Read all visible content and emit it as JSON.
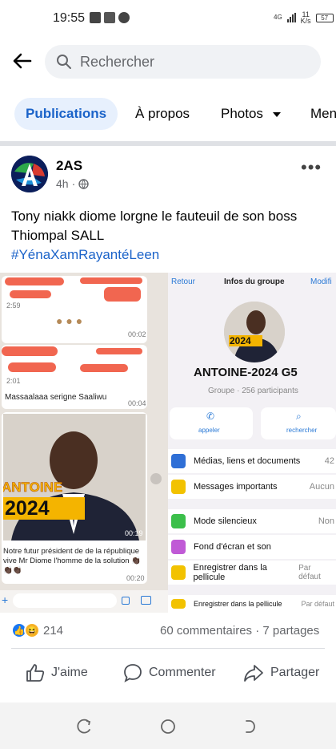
{
  "status_bar": {
    "time": "19:55",
    "network": "4G",
    "speed_value": "11",
    "speed_unit": "K/s",
    "battery": "57"
  },
  "search": {
    "placeholder": "Rechercher"
  },
  "tabs": [
    {
      "label": "Publications",
      "active": true
    },
    {
      "label": "À propos"
    },
    {
      "label": "Photos"
    },
    {
      "label": "Men"
    }
  ],
  "post": {
    "author": "2AS",
    "time": "4h",
    "text": "Tony niakk diome lorgne le fauteuil de son boss Thiompal SALL",
    "hashtag": "#YénaXamRayantéLeen",
    "image": {
      "chat": {
        "msg1_time": "2:59",
        "msg1_stamp": "00:02",
        "msg2_time": "2:01",
        "msg2_caption": "Massaalaaa serigne Saaliwu",
        "msg2_stamp": "00:04",
        "poster_name": "ANTOINE",
        "poster_year": "2024",
        "poster_stamp": "00:19",
        "caption": "Notre futur président de de la république vive Mr Diome l'homme de la solution 👏🏿👏🏿👏🏿",
        "caption_stamp": "00:20"
      },
      "info": {
        "back": "Retour",
        "title": "Infos du groupe",
        "edit": "Modifi",
        "badge_year": "2024",
        "group_name": "ANTOINE-2024 G5",
        "group_sub": "Groupe · 256 participants",
        "call": "appeler",
        "search": "rechercher",
        "rows": [
          {
            "label": "Médias, liens et documents",
            "value": "42",
            "color": "#2f6fd6"
          },
          {
            "label": "Messages importants",
            "value": "Aucun",
            "color": "#f2c200"
          },
          {
            "label": "Mode silencieux",
            "value": "Non",
            "color": "#3bbf4a"
          },
          {
            "label": "Fond d'écran et son",
            "value": "",
            "color": "#c05ad6"
          },
          {
            "label": "Enregistrer dans la pellicule",
            "value": "Par défaut",
            "color": "#f2c200"
          },
          {
            "label": "Enregistrer dans la pellicule",
            "value": "Par défaut",
            "color": "#f2c200"
          }
        ]
      }
    },
    "reactions_count": "214",
    "comments_shares": "60 commentaires · 7 partages",
    "actions": {
      "like": "J'aime",
      "comment": "Commenter",
      "share": "Partager"
    }
  }
}
